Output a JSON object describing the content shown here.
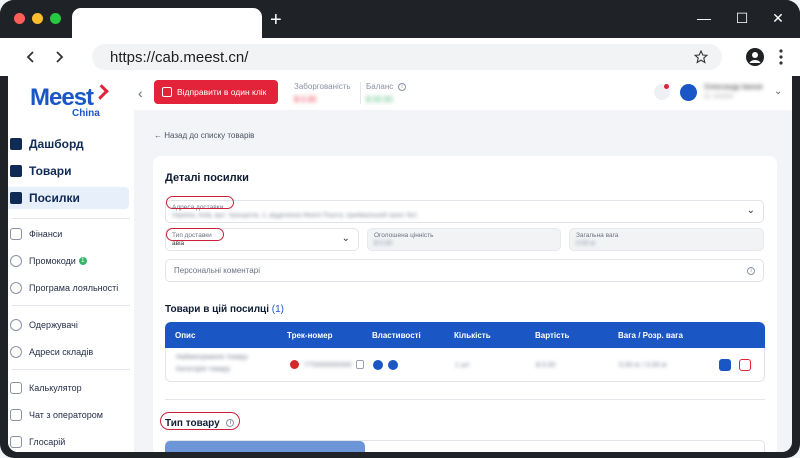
{
  "browser": {
    "url": "https://cab.meest.cn/",
    "new_tab_glyph": "+",
    "window_controls": [
      "—",
      "☐",
      "✕"
    ]
  },
  "logo": {
    "brand": "Meest",
    "sub": "China"
  },
  "sidebar": {
    "items": [
      {
        "label": "Дашборд",
        "icon": "dashboard-icon",
        "style": "big"
      },
      {
        "label": "Товари",
        "icon": "goods-icon",
        "style": "big"
      },
      {
        "label": "Посилки",
        "icon": "parcel-icon",
        "style": "big",
        "active": true
      },
      {
        "label": "Фінанси",
        "icon": "wallet-icon",
        "style": "small"
      },
      {
        "label": "Промокоди",
        "icon": "percent-icon",
        "style": "small",
        "badge": "1"
      },
      {
        "label": "Програма лояльності",
        "icon": "loyalty-icon",
        "style": "small"
      },
      {
        "label": "Одержувачі",
        "icon": "recipients-icon",
        "style": "small"
      },
      {
        "label": "Адреси складів",
        "icon": "location-icon",
        "style": "small"
      },
      {
        "label": "Калькулятор",
        "icon": "calculator-icon",
        "style": "small"
      },
      {
        "label": "Чат з оператором",
        "icon": "chat-icon",
        "style": "small"
      },
      {
        "label": "Глосарій",
        "icon": "book-icon",
        "style": "small"
      }
    ]
  },
  "topbar": {
    "collapse_glyph": "‹",
    "send_button": "Відправити в один клік",
    "debt_label": "Заборгованість",
    "debt_value": "$ 0.00",
    "balance_label": "Баланс",
    "balance_value": "$ 00.00",
    "user_name": "Олександр Іванов",
    "user_id": "ID: 000000",
    "chevron": "⌄"
  },
  "back_link": "← Назад до списку товарів",
  "parcel": {
    "title": "Деталі посилки",
    "address_label": "Адреса доставки",
    "address_value": "Україна, Київ, вул. Хрещатик, 1, відділення Meest Пошта, приймальний пункт №1",
    "delivery_type_label": "Тип доставки",
    "delivery_type_value": "авіа",
    "declared_value_label": "Оголошена цінність",
    "declared_value_value": "$ 0.00",
    "total_weight_label": "Загальна вага",
    "total_weight_value": "0.00 кг",
    "comment_placeholder": "Персональні коментарі"
  },
  "goods": {
    "title": "Товари в цій посилці",
    "count": "(1)",
    "columns": [
      "Опис",
      "Трек-номер",
      "Властивості",
      "Кількість",
      "Вартість",
      "Вага / Розр. вага"
    ],
    "row": {
      "description": "Найменування товару",
      "description_sub": "Категорія товару",
      "track": "YT0000000000",
      "quantity": "1 шт",
      "price": "$ 0.00",
      "weight": "0.00 кг / 0.00 кг"
    }
  },
  "goods_type": {
    "title": "Тип товару"
  },
  "colors": {
    "brand_blue": "#1a56c4",
    "accent_red": "#e2233a",
    "annotation_red": "#c8233a"
  }
}
